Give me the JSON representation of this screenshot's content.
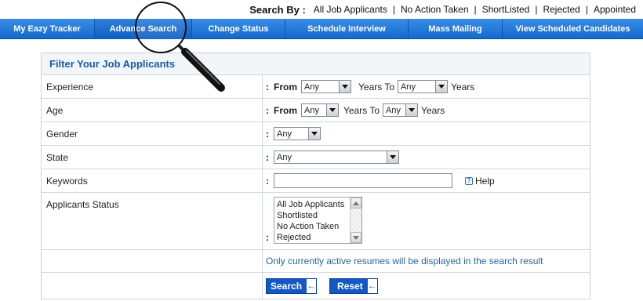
{
  "search_by": {
    "label": "Search By :",
    "links": [
      "All Job Applicants",
      "No Action Taken",
      "ShortListed",
      "Rejected",
      "Appointed"
    ]
  },
  "nav": {
    "items": [
      {
        "label": "My Eazy Tracker"
      },
      {
        "label": "Advance Search"
      },
      {
        "label": "Change Status"
      },
      {
        "label": "Schedule Interview"
      },
      {
        "label": "Mass Mailing"
      },
      {
        "label": "View Scheduled Candidates"
      }
    ],
    "active": "Advance Search"
  },
  "panel": {
    "title": "Filter Your Job Applicants",
    "colon": ":",
    "experience": {
      "label": "Experience",
      "from_label": "From",
      "from_value": "Any",
      "to_label": "Years To",
      "to_value": "Any",
      "unit": "Years"
    },
    "age": {
      "label": "Age",
      "from_label": "From",
      "from_value": "Any",
      "to_label": "Years To",
      "to_value": "Any",
      "unit": "Years"
    },
    "gender": {
      "label": "Gender",
      "value": "Any"
    },
    "state": {
      "label": "State",
      "value": "Any"
    },
    "keywords": {
      "label": "Keywords",
      "value": "",
      "help": "Help"
    },
    "status": {
      "label": "Applicants Status",
      "options": [
        "All Job Applicants",
        "Shortlisted",
        "No Action Taken",
        "Rejected"
      ]
    },
    "note": "Only currently active resumes will be displayed in the search result",
    "search_button": "Search",
    "reset_button": "Reset"
  },
  "colors": {
    "nav_blue": "#1469cc",
    "title_blue": "#1a5aa8",
    "button_blue": "#1458c8"
  },
  "icons": {
    "help": "help-icon",
    "magnifier": "magnifier-icon",
    "arrow": "arrow-left-icon"
  }
}
